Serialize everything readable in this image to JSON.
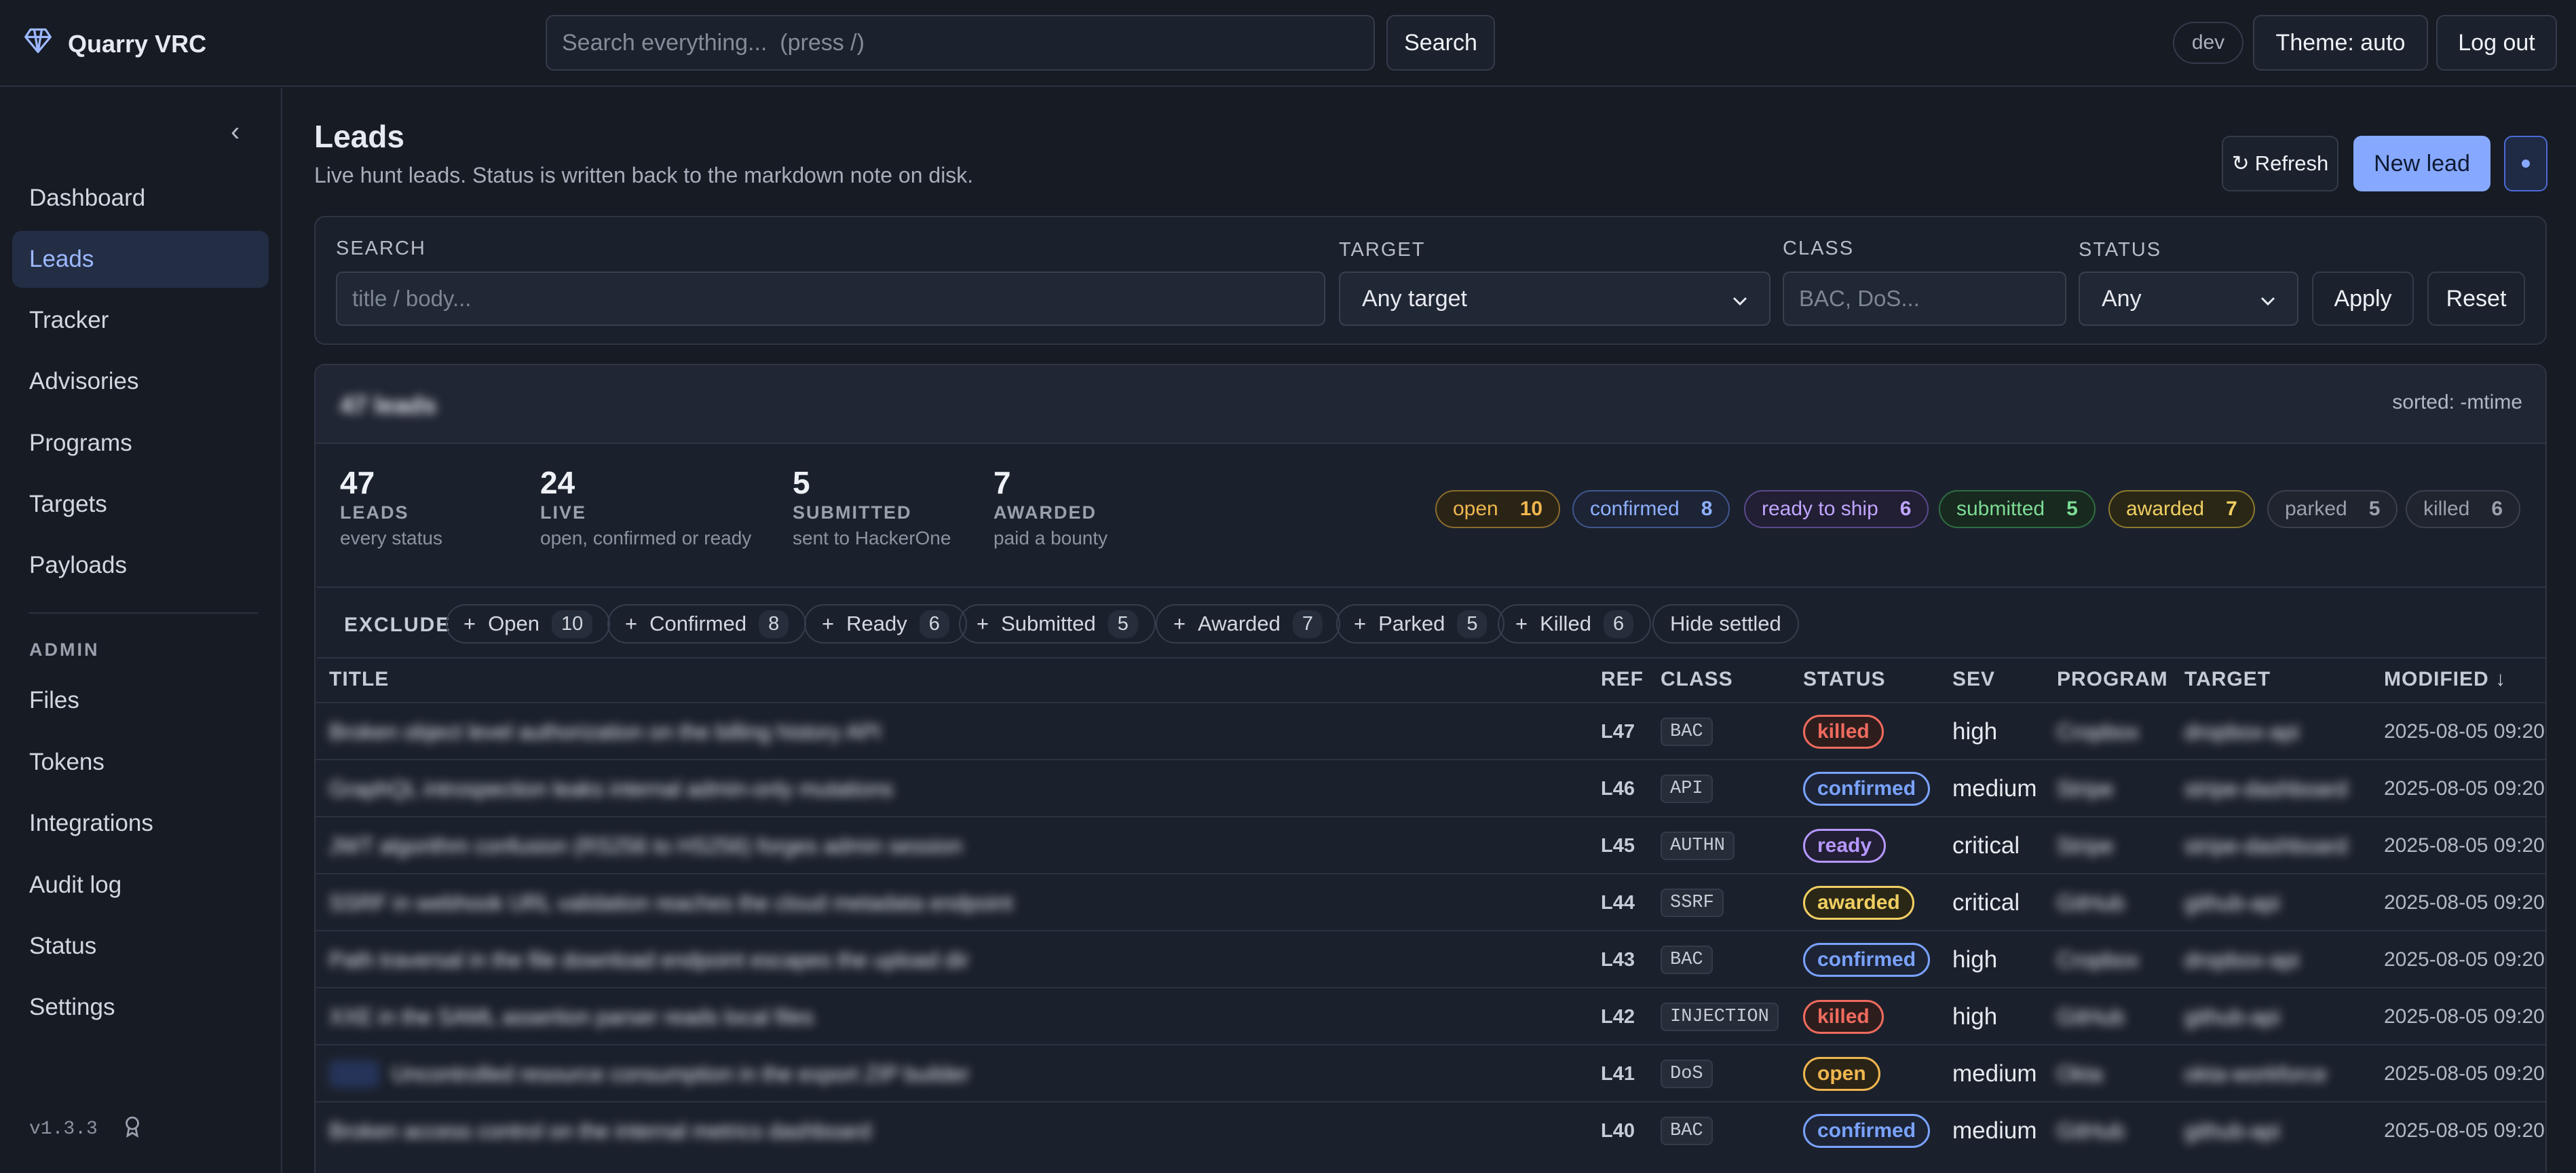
{
  "app": {
    "name": "Quarry VRC",
    "env": "dev",
    "version": "v1.3.3"
  },
  "topbar": {
    "search_placeholder": "Search everything...  (press /)",
    "search_button": "Search",
    "theme_button": "Theme: auto",
    "logout_button": "Log out"
  },
  "sidebar": {
    "items": [
      "Dashboard",
      "Leads",
      "Tracker",
      "Advisories",
      "Programs",
      "Targets",
      "Payloads"
    ],
    "admin_heading": "ADMIN",
    "admin_items": [
      "Files",
      "Tokens",
      "Integrations",
      "Audit log",
      "Status",
      "Settings"
    ]
  },
  "page": {
    "title": "Leads",
    "subtitle": "Live hunt leads. Status is written back to the markdown note on disk.",
    "refresh_button": "Refresh",
    "new_button": "New lead"
  },
  "filters": {
    "search_label": "SEARCH",
    "search_placeholder": "title / body...",
    "target_label": "TARGET",
    "target_value": "Any target",
    "class_label": "CLASS",
    "class_placeholder": "BAC, DoS...",
    "status_label": "STATUS",
    "status_value": "Any",
    "apply_button": "Apply",
    "reset_button": "Reset"
  },
  "results": {
    "heading": "47 leads",
    "sort_label": "sorted: -mtime",
    "stats": [
      {
        "num": "47",
        "label": "LEADS",
        "sub": "every status"
      },
      {
        "num": "24",
        "label": "LIVE",
        "sub": "open, confirmed or ready"
      },
      {
        "num": "5",
        "label": "SUBMITTED",
        "sub": "sent to HackerOne"
      },
      {
        "num": "7",
        "label": "AWARDED",
        "sub": "paid a bounty"
      }
    ],
    "status_pills": [
      {
        "label": "open",
        "count": "10",
        "color": "#f0b64f"
      },
      {
        "label": "confirmed",
        "count": "8",
        "color": "#7aa2ff"
      },
      {
        "label": "ready to ship",
        "count": "6",
        "color": "#b597ff"
      },
      {
        "label": "submitted",
        "count": "5",
        "color": "#6fd38a"
      },
      {
        "label": "awarded",
        "count": "7",
        "color": "#f0cf62"
      },
      {
        "label": "parked",
        "count": "5",
        "color": "#9aa1ad"
      },
      {
        "label": "killed",
        "count": "6",
        "color": "#9aa1ad"
      }
    ],
    "exclude_label": "EXCLUDE",
    "exclude_chips": [
      {
        "label": "Open",
        "count": "10"
      },
      {
        "label": "Confirmed",
        "count": "8"
      },
      {
        "label": "Ready",
        "count": "6"
      },
      {
        "label": "Submitted",
        "count": "5"
      },
      {
        "label": "Awarded",
        "count": "7"
      },
      {
        "label": "Parked",
        "count": "5"
      },
      {
        "label": "Killed",
        "count": "6"
      }
    ],
    "hide_settled": "Hide settled",
    "columns": {
      "title": "TITLE",
      "ref": "REF",
      "class": "CLASS",
      "status": "STATUS",
      "sev": "SEV",
      "program": "PROGRAM",
      "target": "TARGET",
      "modified": "MODIFIED ↓"
    },
    "rows": [
      {
        "title": "Broken object level authorization on the billing history API",
        "ref": "L47",
        "class": "BAC",
        "status": "killed",
        "sev": "high",
        "program": "Cropbox",
        "target": "dropbox-api",
        "modified": "2025-08-05 09:20"
      },
      {
        "title": "GraphQL introspection leaks internal admin-only mutations",
        "ref": "L46",
        "class": "API",
        "status": "confirmed",
        "sev": "medium",
        "program": "Stripe",
        "target": "stripe-dashboard",
        "modified": "2025-08-05 09:20"
      },
      {
        "title": "JWT algorithm confusion (RS256 to HS256) forges admin session",
        "ref": "L45",
        "class": "AUTHN",
        "status": "ready",
        "sev": "critical",
        "program": "Stripe",
        "target": "stripe-dashboard",
        "modified": "2025-08-05 09:20"
      },
      {
        "title": "SSRF in webhook URL validation reaches the cloud metadata endpoint",
        "ref": "L44",
        "class": "SSRF",
        "status": "awarded",
        "sev": "critical",
        "program": "GitHub",
        "target": "github-api",
        "modified": "2025-08-05 09:20"
      },
      {
        "title": "Path traversal in the file download endpoint escapes the upload dir",
        "ref": "L43",
        "class": "BAC",
        "status": "confirmed",
        "sev": "high",
        "program": "Cropbox",
        "target": "dropbox-api",
        "modified": "2025-08-05 09:20"
      },
      {
        "title": "XXE in the SAML assertion parser reads local files",
        "ref": "L42",
        "class": "INJECTION",
        "status": "killed",
        "sev": "high",
        "program": "GitHub",
        "target": "github-api",
        "modified": "2025-08-05 09:20"
      },
      {
        "title": "Uncontrolled resource consumption in the export ZIP builder",
        "ref": "L41",
        "class": "DoS",
        "status": "open",
        "sev": "medium",
        "program": "Okta",
        "target": "okta-workforce",
        "modified": "2025-08-05 09:20"
      },
      {
        "title": "Broken access control on the internal metrics dashboard",
        "ref": "L40",
        "class": "BAC",
        "status": "confirmed",
        "sev": "medium",
        "program": "GitHub",
        "target": "github-api",
        "modified": "2025-08-05 09:20"
      }
    ]
  },
  "status_colors": {
    "killed": "#ef6b5e",
    "confirmed": "#7aa2ff",
    "ready": "#b597ff",
    "awarded": "#f0cf62",
    "open": "#f0b64f"
  }
}
